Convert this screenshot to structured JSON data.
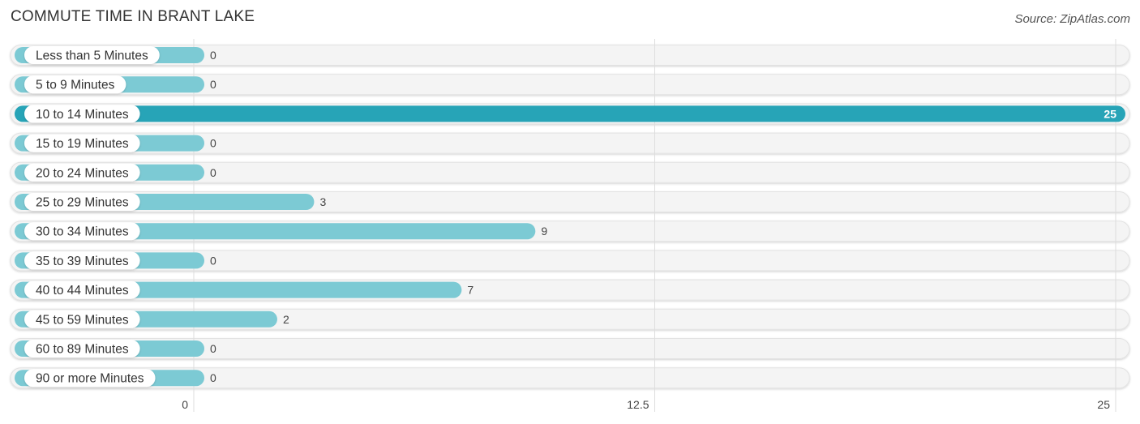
{
  "header": {
    "title": "COMMUTE TIME IN BRANT LAKE",
    "source": "Source: ZipAtlas.com"
  },
  "colors": {
    "bar": "#7ccad4",
    "bar_highlight": "#27a4b7",
    "track": "#f4f4f4",
    "grid": "#dddddd"
  },
  "chart_data": {
    "type": "bar",
    "orientation": "horizontal",
    "title": "COMMUTE TIME IN BRANT LAKE",
    "xlabel": "",
    "ylabel": "",
    "categories": [
      "Less than 5 Minutes",
      "5 to 9 Minutes",
      "10 to 14 Minutes",
      "15 to 19 Minutes",
      "20 to 24 Minutes",
      "25 to 29 Minutes",
      "30 to 34 Minutes",
      "35 to 39 Minutes",
      "40 to 44 Minutes",
      "45 to 59 Minutes",
      "60 to 89 Minutes",
      "90 or more Minutes"
    ],
    "values": [
      0,
      0,
      25,
      0,
      0,
      3,
      9,
      0,
      7,
      2,
      0,
      0
    ],
    "xlim": [
      0,
      25
    ],
    "xticks": [
      0,
      12.5,
      25
    ],
    "xtick_labels": [
      "0",
      "12.5",
      "25"
    ],
    "grid": true,
    "legend": "none"
  }
}
